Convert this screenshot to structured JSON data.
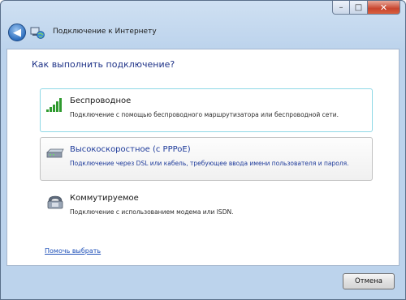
{
  "window": {
    "title": "Подключение к Интернету"
  },
  "caption": {
    "minimize": "–",
    "maximize": "□",
    "close": "✕"
  },
  "heading": "Как выполнить подключение?",
  "options": [
    {
      "title": "Беспроводное",
      "description": "Подключение с помощью беспроводного маршрутизатора или беспроводной сети.",
      "icon": "wireless-signal-icon"
    },
    {
      "title": "Высокоскоростное (с PPPoE)",
      "description": "Подключение через DSL или кабель, требующее ввода имени пользователя и пароля.",
      "icon": "broadband-modem-icon"
    },
    {
      "title": "Коммутируемое",
      "description": "Подключение с использованием модема или ISDN.",
      "icon": "dialup-phone-icon"
    }
  ],
  "help_link": "Помочь выбрать",
  "footer": {
    "cancel_label": "Отмена"
  },
  "colors": {
    "heading": "#1e3287",
    "link": "#1d4fb8",
    "selected_border": "#8fd8e6"
  }
}
